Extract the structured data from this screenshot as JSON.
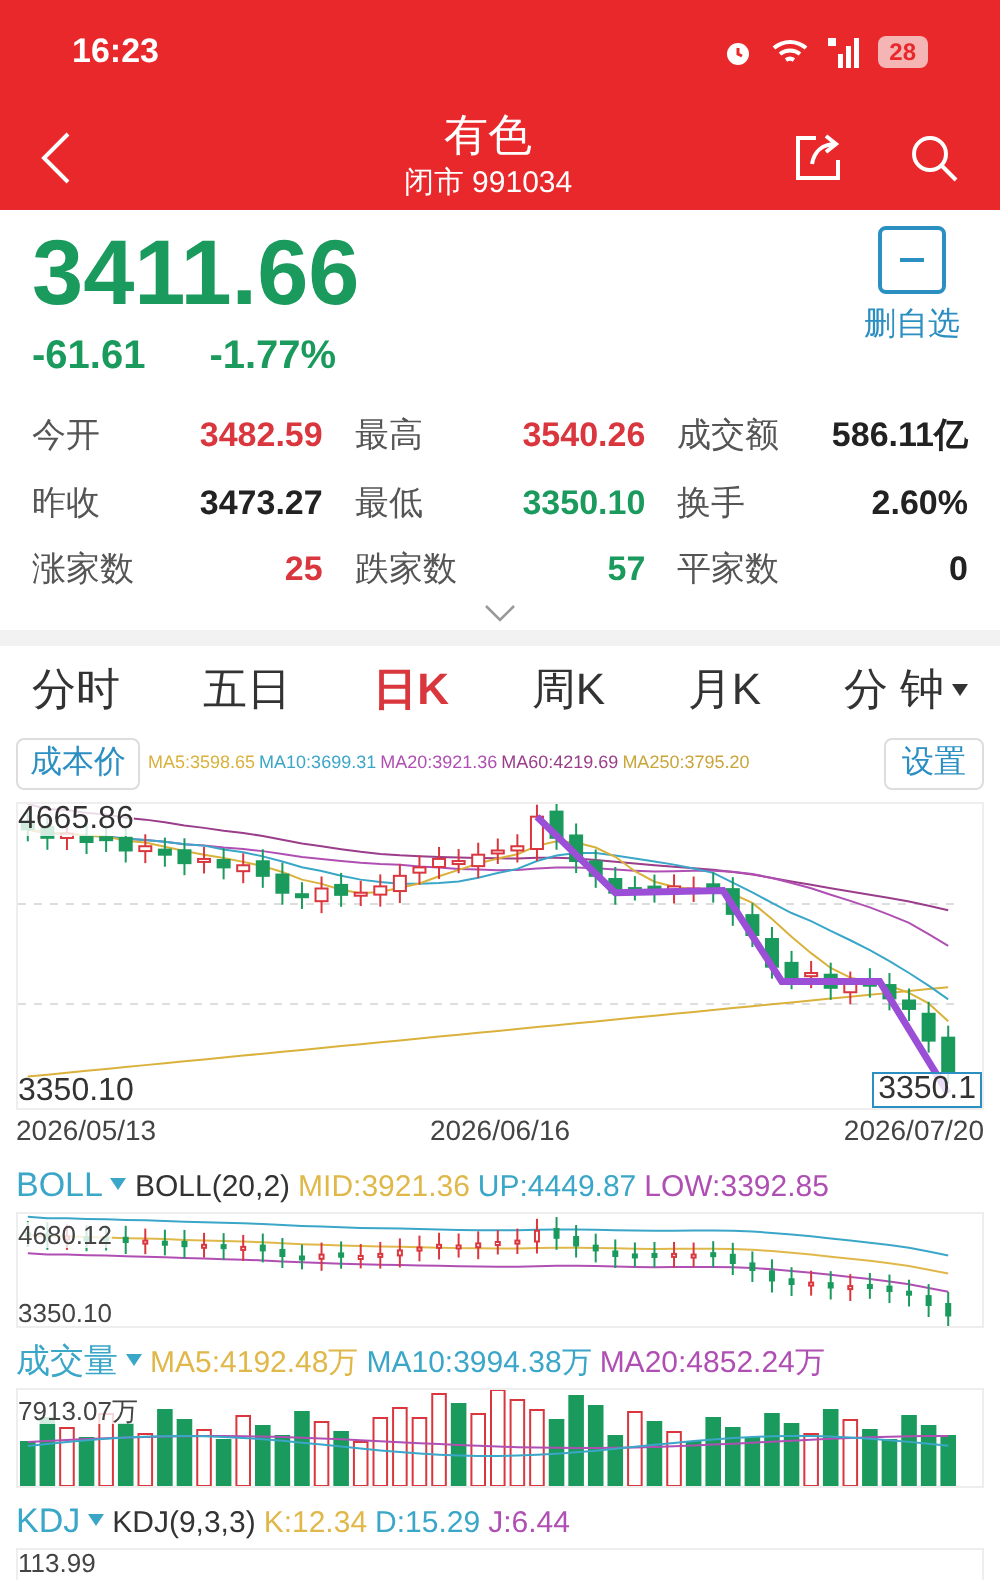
{
  "status_bar": {
    "time": "16:23",
    "battery": "28"
  },
  "header": {
    "title": "有色",
    "subtitle": "闭市 991034"
  },
  "quote": {
    "color": "#1a9a5c",
    "price": "3411.66",
    "change": "-61.61",
    "change_pct": "-1.77%",
    "watchlist_label": "删自选"
  },
  "stats": [
    {
      "label": "今开",
      "value": "3482.59",
      "color": "#d9363e"
    },
    {
      "label": "最高",
      "value": "3540.26",
      "color": "#d9363e"
    },
    {
      "label": "成交额",
      "value": "586.11亿",
      "color": "#222222"
    },
    {
      "label": "昨收",
      "value": "3473.27",
      "color": "#222222"
    },
    {
      "label": "最低",
      "value": "3350.10",
      "color": "#1a9a5c"
    },
    {
      "label": "换手",
      "value": "2.60%",
      "color": "#222222"
    },
    {
      "label": "涨家数",
      "value": "25",
      "color": "#d9363e"
    },
    {
      "label": "跌家数",
      "value": "57",
      "color": "#1a9a5c"
    },
    {
      "label": "平家数",
      "value": "0",
      "color": "#222222"
    }
  ],
  "tabs": [
    {
      "label": "分时",
      "selected": false,
      "kind": "plain"
    },
    {
      "label": "五日",
      "selected": false,
      "kind": "plain"
    },
    {
      "label": "日K",
      "selected": true,
      "kind": "plain"
    },
    {
      "label": "周K",
      "selected": false,
      "kind": "plain"
    },
    {
      "label": "月K",
      "selected": false,
      "kind": "plain"
    },
    {
      "label": "分 钟",
      "selected": false,
      "kind": "dropdown"
    }
  ],
  "main_chart": {
    "cost_button": "成本价",
    "settings_button": "设置",
    "ma_legend": [
      {
        "text": "MA5:3598.65",
        "color": "#d9b13b"
      },
      {
        "text": "MA10:3699.31",
        "color": "#3aa6c8"
      },
      {
        "text": "MA20:3921.36",
        "color": "#b04fb3"
      },
      {
        "text": "MA60:4219.69",
        "color": "#9a3d8a"
      },
      {
        "text": "MA250:3795.20",
        "color": "#c9a53a"
      }
    ],
    "max_label": "4665.86",
    "min_label": "3350.10",
    "last_label": "3350.1",
    "dates": [
      "2026/05/13",
      "2026/06/16",
      "2026/07/20"
    ]
  },
  "indicators": [
    {
      "kind": "boll",
      "name": "BOLL",
      "params": "BOLL(20,2)",
      "values": [
        {
          "text": "MID:3921.36",
          "color": "#e0b84a"
        },
        {
          "text": "UP:4449.87",
          "color": "#3aa6c8"
        },
        {
          "text": "LOW:3392.85",
          "color": "#b04fb3"
        }
      ],
      "top_label": "4680.12",
      "bottom_label": "3350.10"
    },
    {
      "kind": "volume",
      "name": "成交量",
      "values": [
        {
          "text": "MA5:4192.48万",
          "color": "#e0b84a"
        },
        {
          "text": "MA10:3994.38万",
          "color": "#3aa6c8"
        },
        {
          "text": "MA20:4852.24万",
          "color": "#b04fb3"
        }
      ],
      "top_label": "7913.07万"
    },
    {
      "kind": "kdj",
      "name": "KDJ",
      "params": "KDJ(9,3,3)",
      "values": [
        {
          "text": "K:12.34",
          "color": "#e0b84a"
        },
        {
          "text": "D:15.29",
          "color": "#3aa6c8"
        },
        {
          "text": "J:6.44",
          "color": "#b04fb3"
        }
      ],
      "top_label": "113.99"
    }
  ]
}
